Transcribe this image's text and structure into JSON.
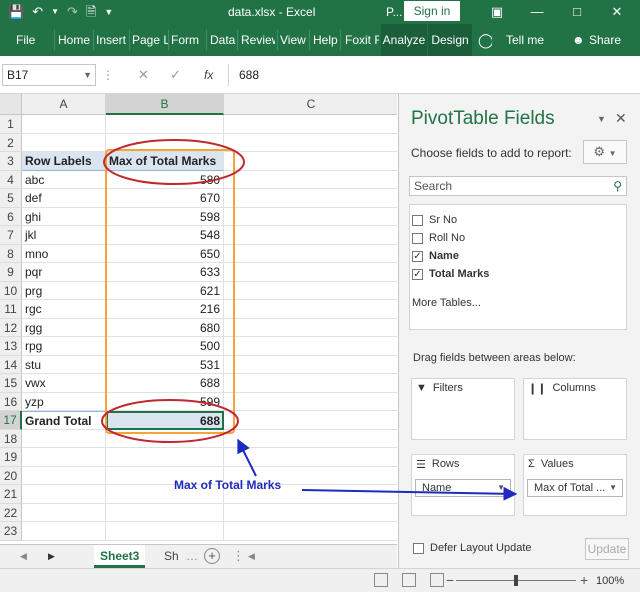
{
  "titlebar": {
    "title": "data.xlsx  -  Excel",
    "p_label": "P...",
    "signin": "Sign in",
    "icons": [
      "save-icon",
      "undo-icon",
      "redo-icon",
      "print-preview-icon",
      "customize-qat-icon"
    ],
    "controls": [
      "ribbon-display-icon",
      "minimize-icon",
      "maximize-icon",
      "close-icon"
    ]
  },
  "ribbon": {
    "tabs": [
      "File",
      "Home",
      "Insert",
      "Page L",
      "Form",
      "Data",
      "Review",
      "View",
      "Help",
      "Foxit F",
      "Analyze",
      "Design"
    ],
    "tell_me": "Tell me",
    "share": "Share"
  },
  "formula_bar": {
    "name_box": "B17",
    "value": "688"
  },
  "grid": {
    "columns": [
      "A",
      "B",
      "C"
    ],
    "rows": [
      "1",
      "2",
      "3",
      "4",
      "5",
      "6",
      "7",
      "8",
      "9",
      "10",
      "11",
      "12",
      "13",
      "14",
      "15",
      "16",
      "17",
      "18",
      "19",
      "20",
      "21",
      "22",
      "23"
    ],
    "header_row": {
      "a": "Row Labels",
      "b": "Max of Total Marks"
    },
    "data": [
      {
        "label": "abc",
        "value": "580"
      },
      {
        "label": "def",
        "value": "670"
      },
      {
        "label": "ghi",
        "value": "598"
      },
      {
        "label": "jkl",
        "value": "548"
      },
      {
        "label": "mno",
        "value": "650"
      },
      {
        "label": "pqr",
        "value": "633"
      },
      {
        "label": "prg",
        "value": "621"
      },
      {
        "label": "rgc",
        "value": "216"
      },
      {
        "label": "rgg",
        "value": "680"
      },
      {
        "label": "rpg",
        "value": "500"
      },
      {
        "label": "stu",
        "value": "531"
      },
      {
        "label": "vwx",
        "value": "688"
      },
      {
        "label": "yzp",
        "value": "599"
      }
    ],
    "total": {
      "label": "Grand Total",
      "value": "688"
    }
  },
  "sheets": {
    "tabs": [
      "Sheet3",
      "Sh"
    ],
    "active": "Sheet3"
  },
  "status": {
    "zoom": "100%",
    "zoom_fraction": 0.5
  },
  "pivot_panel": {
    "title": "PivotTable Fields",
    "choose_label": "Choose fields to add to report:",
    "search_placeholder": "Search",
    "fields": [
      {
        "name": "Sr No",
        "checked": false
      },
      {
        "name": "Roll No",
        "checked": false
      },
      {
        "name": "Name",
        "checked": true
      },
      {
        "name": "Total Marks",
        "checked": true
      }
    ],
    "more_tables": "More Tables...",
    "drag_label": "Drag fields between areas below:",
    "areas": {
      "filters": "Filters",
      "columns": "Columns",
      "rows": "Rows",
      "values": "Values",
      "rows_item": "Name",
      "values_item": "Max of Total ..."
    },
    "defer_label": "Defer Layout Update",
    "update_label": "Update"
  },
  "annotation": {
    "text": "Max of Total Marks",
    "color": "#1f2bbf",
    "highlight_color": "#c0282d",
    "column_highlight_color": "#f2a33a"
  }
}
